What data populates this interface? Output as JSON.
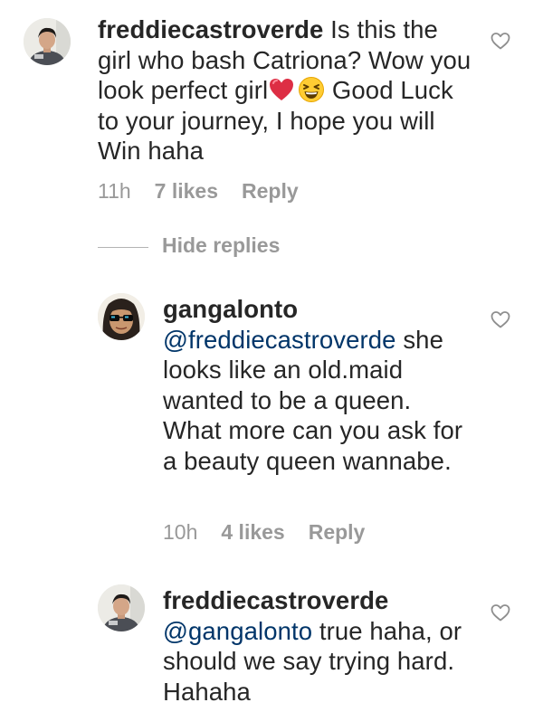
{
  "comments": [
    {
      "username": "freddiecastroverde",
      "text_before": " Is this the girl who bash Catriona? Wow you look perfect girl",
      "text_after": " Good Luck to your journey, I hope you will Win haha",
      "emoji_1": "red-heart-emoji",
      "emoji_2": "grinning-squinting-face-emoji",
      "time": "11h",
      "likes": "7 likes",
      "reply": "Reply"
    },
    {
      "username": "gangalonto",
      "mention": "@freddiecastroverde",
      "text": " she looks like an old.maid wanted to be a queen. What more can you ask for a beauty queen wannabe.",
      "time": "10h",
      "likes": "4 likes",
      "reply": "Reply"
    },
    {
      "username": "freddiecastroverde",
      "mention": "@gangalonto",
      "text": " true haha, or should we say trying hard. Hahaha"
    }
  ],
  "hide_replies": "Hide replies",
  "colors": {
    "text": "#262626",
    "secondary": "#999999",
    "mention": "#003569"
  }
}
